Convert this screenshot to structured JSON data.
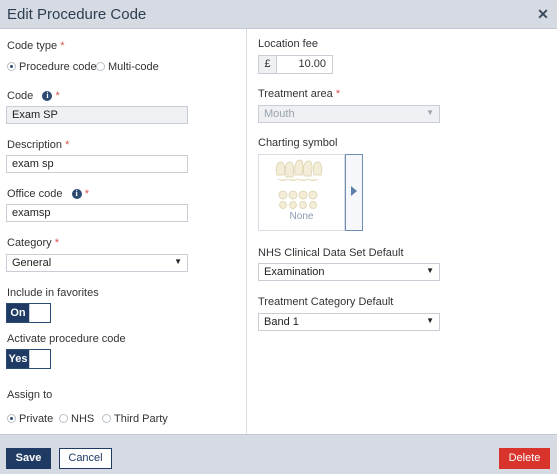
{
  "dialog": {
    "title": "Edit Procedure Code",
    "close_glyph": "✕"
  },
  "left": {
    "code_type": {
      "label": "Code type",
      "required": "*",
      "options": [
        "Procedure code",
        "Multi-code"
      ],
      "selected": "Procedure code"
    },
    "code": {
      "label": "Code",
      "required": "*",
      "value": "Exam SP"
    },
    "description": {
      "label": "Description",
      "required": "*",
      "value": "exam sp"
    },
    "office_code": {
      "label": "Office code",
      "required": "*",
      "value": "examsp"
    },
    "category": {
      "label": "Category",
      "required": "*",
      "value": "General"
    },
    "favorites": {
      "label": "Include in favorites",
      "toggle_text": "On"
    },
    "activate": {
      "label": "Activate procedure code",
      "toggle_text": "Yes"
    },
    "assign_to": {
      "label": "Assign to",
      "options": [
        "Private",
        "NHS",
        "Third Party"
      ],
      "selected": "Private"
    }
  },
  "right": {
    "location_fee": {
      "label": "Location fee",
      "currency": "£",
      "value": "10.00"
    },
    "treatment_area": {
      "label": "Treatment area",
      "required": "*",
      "value": "Mouth"
    },
    "charting_symbol": {
      "label": "Charting symbol",
      "value": "None"
    },
    "nhs_default": {
      "label": "NHS Clinical Data Set Default",
      "value": "Examination"
    },
    "treatment_category": {
      "label": "Treatment Category Default",
      "value": "Band 1"
    }
  },
  "footer": {
    "save": "Save",
    "cancel": "Cancel",
    "delete": "Delete"
  },
  "icons": {
    "info": "info-icon",
    "caret": "caret-down-icon",
    "close": "close-icon",
    "arrow": "arrow-right-icon"
  },
  "colors": {
    "primary": "#1f3a63",
    "danger": "#d9342b",
    "header_bg": "#d6dbe3",
    "required": "#d9534f"
  }
}
